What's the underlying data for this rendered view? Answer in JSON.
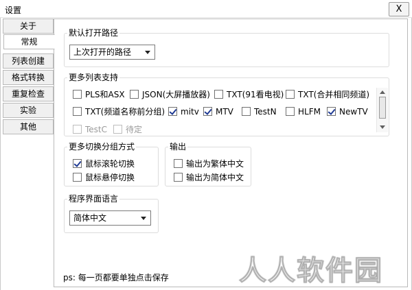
{
  "window": {
    "title": "设置",
    "close_label": "X"
  },
  "tabs": [
    {
      "label": "关于",
      "active": false
    },
    {
      "label": "常规",
      "active": true
    },
    {
      "label": "列表创建",
      "active": false
    },
    {
      "label": "格式转换",
      "active": false
    },
    {
      "label": "重复检查",
      "active": false
    },
    {
      "label": "实验",
      "active": false
    },
    {
      "label": "其他",
      "active": false
    }
  ],
  "default_path": {
    "title": "默认打开路径",
    "selected": "上次打开的路径"
  },
  "more_lists": {
    "title": "更多列表支持",
    "items": [
      {
        "label": "PLS和ASX",
        "checked": false,
        "disabled": false
      },
      {
        "label": "JSON(大屏播放器)",
        "checked": false,
        "disabled": false
      },
      {
        "label": "TXT(91看电视)",
        "checked": false,
        "disabled": false
      },
      {
        "label": "TXT(合并相同频道)",
        "checked": false,
        "disabled": false
      },
      {
        "label": "TXT(频道名称前分组)",
        "checked": false,
        "disabled": false
      },
      {
        "label": "mitv",
        "checked": true,
        "disabled": false
      },
      {
        "label": "MTV",
        "checked": true,
        "disabled": false
      },
      {
        "label": "TestN",
        "checked": false,
        "disabled": false
      },
      {
        "label": "HLFM",
        "checked": false,
        "disabled": false
      },
      {
        "label": "NewTV",
        "checked": true,
        "disabled": false
      },
      {
        "label": "TestC",
        "checked": false,
        "disabled": true
      },
      {
        "label": "待定",
        "checked": false,
        "disabled": true
      }
    ]
  },
  "group_switch": {
    "title": "更多切换分组方式",
    "items": [
      {
        "label": "鼠标滚轮切换",
        "checked": true
      },
      {
        "label": "鼠标悬停切换",
        "checked": false
      }
    ]
  },
  "output": {
    "title": "输出",
    "items": [
      {
        "label": "输出为繁体中文",
        "checked": false
      },
      {
        "label": "输出为简体中文",
        "checked": false
      }
    ]
  },
  "language": {
    "title": "程序界面语言",
    "selected": "简体中文"
  },
  "note": "ps: 每一页都要单独点击保存",
  "watermark": "人人软件园",
  "colors": {
    "check": "#1f3a93",
    "border": "#b9b9b9"
  }
}
